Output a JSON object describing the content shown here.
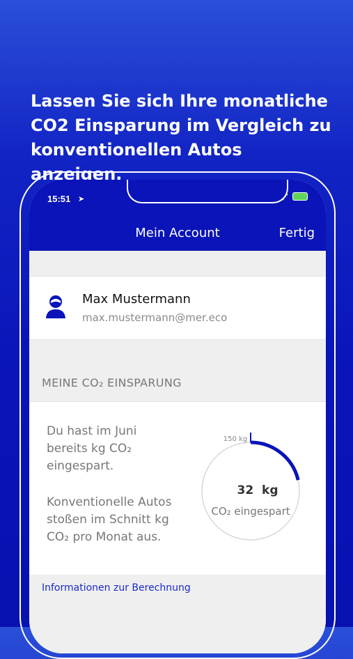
{
  "headline": "Lassen Sie sich Ihre monatliche CO2 Einsparung im Vergleich zu konventionellen Autos anzeigen.",
  "status": {
    "time": "15:51",
    "signal": "....."
  },
  "nav": {
    "title": "Mein Account",
    "done_label": "Fertig"
  },
  "profile": {
    "name": "Max Mustermann",
    "email": "max.mustermann@mer.eco"
  },
  "savings": {
    "section_label": "MEINE CO₂ EINSPARUNG",
    "text_month": "Du hast im Juni bereits  kg CO₂ eingespart.",
    "text_conventional": "Konventionelle Autos stoßen im Schnitt  kg CO₂ pro Monat aus.",
    "gauge_max_label": "150 kg",
    "gauge_value_label": "32  kg",
    "gauge_caption": "CO₂ eingespart",
    "gauge_value": 32,
    "gauge_max": 150,
    "accent": "#0a14b8"
  },
  "info_link": "Informationen zur Berechnung"
}
